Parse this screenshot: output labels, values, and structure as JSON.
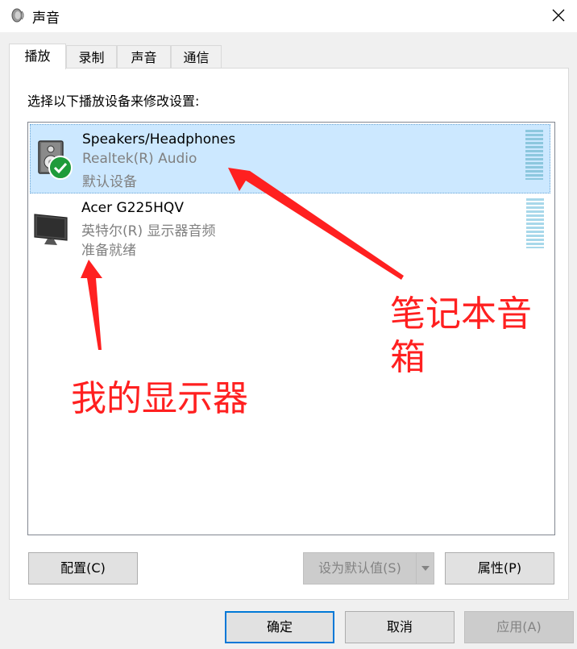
{
  "window": {
    "title": "声音",
    "icon": "speaker-icon",
    "close_icon": "close-icon"
  },
  "tabs": [
    {
      "label": "播放",
      "active": true
    },
    {
      "label": "录制",
      "active": false
    },
    {
      "label": "声音",
      "active": false
    },
    {
      "label": "通信",
      "active": false
    }
  ],
  "instruction": "选择以下播放设备来修改设置:",
  "devices": [
    {
      "name": "Speakers/Headphones",
      "driver": "Realtek(R) Audio",
      "status": "默认设备",
      "icon": "speaker-device-icon",
      "badge": "default-check-icon",
      "selected": true
    },
    {
      "name": "Acer G225HQV",
      "driver": "英特尔(R) 显示器音频",
      "status": "准备就绪",
      "icon": "monitor-icon",
      "selected": false
    }
  ],
  "buttons": {
    "configure": "配置(C)",
    "set_default": "设为默认值(S)",
    "properties": "属性(P)",
    "ok": "确定",
    "cancel": "取消",
    "apply": "应用(A)"
  },
  "annotations": {
    "speaker_label": "笔记本音箱",
    "monitor_label": "我的显示器",
    "color": "#ff2020"
  },
  "colors": {
    "selection": "#cce8ff",
    "accent": "#0078d7",
    "check_green": "#1e9b3a"
  }
}
